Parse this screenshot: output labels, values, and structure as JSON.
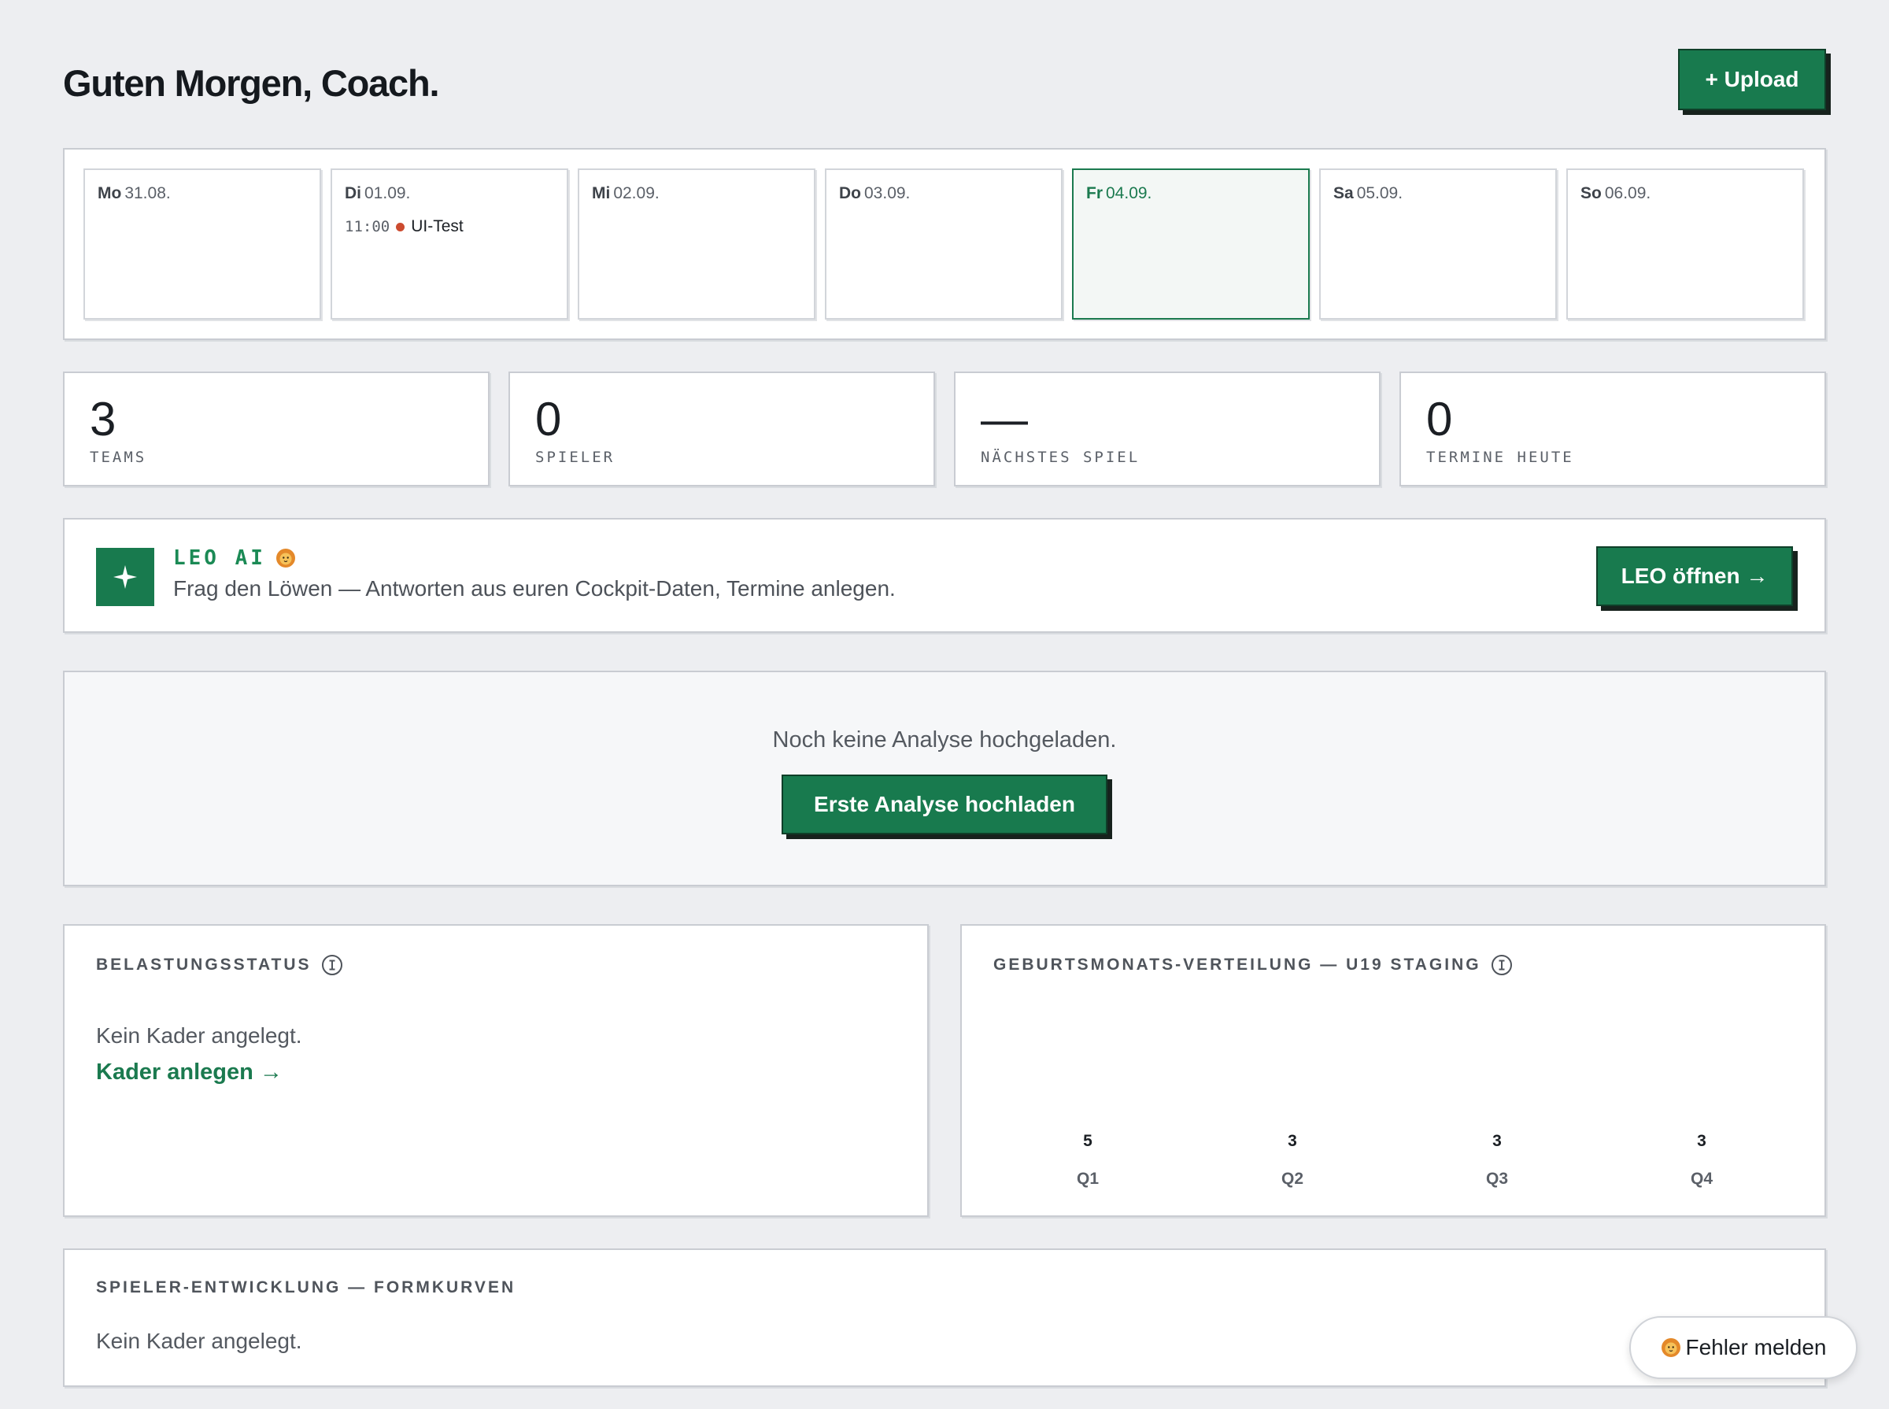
{
  "header": {
    "title": "Guten Morgen, Coach.",
    "upload_label": "+ Upload"
  },
  "week": [
    {
      "dow": "Mo",
      "date": "31.08.",
      "today": false
    },
    {
      "dow": "Di",
      "date": "01.09.",
      "today": false,
      "event": {
        "time": "11:00",
        "title": "UI-Test",
        "color": "#cc4b2f"
      }
    },
    {
      "dow": "Mi",
      "date": "02.09.",
      "today": false
    },
    {
      "dow": "Do",
      "date": "03.09.",
      "today": false
    },
    {
      "dow": "Fr",
      "date": "04.09.",
      "today": true
    },
    {
      "dow": "Sa",
      "date": "05.09.",
      "today": false
    },
    {
      "dow": "So",
      "date": "06.09.",
      "today": false
    }
  ],
  "stats": [
    {
      "value": "3",
      "label": "TEAMS"
    },
    {
      "value": "0",
      "label": "SPIELER"
    },
    {
      "value": "—",
      "label": "NÄCHSTES SPIEL"
    },
    {
      "value": "0",
      "label": "TERMINE HEUTE"
    }
  ],
  "leo": {
    "icon": "sparkle-icon",
    "title": "LEO AI",
    "emoji_icon": "lion-icon",
    "description": "Frag den Löwen — Antworten aus euren Cockpit-Daten, Termine anlegen.",
    "button_label": "LEO öffnen →"
  },
  "analysis": {
    "empty_text": "Noch keine Analyse hochgeladen.",
    "button_label": "Erste Analyse hochladen"
  },
  "load_status": {
    "title": "BELASTUNGSSTATUS",
    "empty_text": "Kein Kader angelegt.",
    "link_label": "Kader anlegen →"
  },
  "birth_distribution": {
    "title": "GEBURTSMONATS-VERTEILUNG — U19 STAGING"
  },
  "chart_data": {
    "type": "bar",
    "categories": [
      "Q1",
      "Q2",
      "Q3",
      "Q4"
    ],
    "values": [
      5,
      3,
      3,
      3
    ]
  },
  "development": {
    "title": "SPIELER-ENTWICKLUNG — FORMKURVEN",
    "empty_text": "Kein Kader angelegt."
  },
  "report": {
    "label": "Fehler melden",
    "icon": "lion-icon"
  },
  "colors": {
    "accent": "#187a4e",
    "background": "#edeef1",
    "event_dot": "#cc4b2f"
  }
}
